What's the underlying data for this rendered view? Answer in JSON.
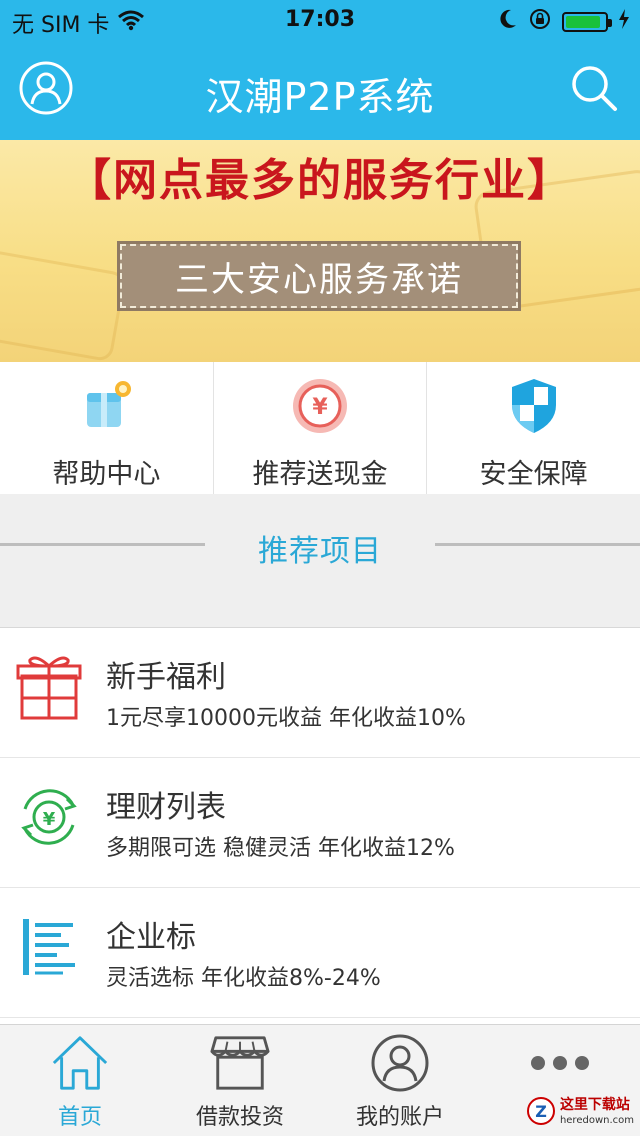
{
  "status_bar": {
    "carrier": "无 SIM 卡",
    "time": "17:03",
    "battery_level": 0.9
  },
  "header": {
    "title": "汉潮P2P系统",
    "left_icon": "user-icon",
    "right_icon": "search-icon"
  },
  "banner": {
    "headline": "【网点最多的服务行业】",
    "subtitle": "三大安心服务承诺"
  },
  "quick_menu": [
    {
      "label": "帮助中心",
      "icon": "gift-box-icon"
    },
    {
      "label": "推荐送现金",
      "icon": "yen-coin-icon"
    },
    {
      "label": "安全保障",
      "icon": "shield-icon"
    }
  ],
  "section": {
    "title": "推荐项目"
  },
  "products": [
    {
      "title": "新手福利",
      "desc": "1元尽享10000元收益 年化收益10%",
      "icon": "gift-icon"
    },
    {
      "title": "理财列表",
      "desc": "多期限可选 稳健灵活 年化收益12%",
      "icon": "yen-cycle-icon"
    },
    {
      "title": "企业标",
      "desc": "灵活选标 年化收益8%-24%",
      "icon": "list-icon"
    }
  ],
  "tab_bar": {
    "tabs": [
      {
        "label": "首页",
        "icon": "home-icon",
        "active": true
      },
      {
        "label": "借款投资",
        "icon": "shop-icon",
        "active": false
      },
      {
        "label": "我的账户",
        "icon": "account-icon",
        "active": false
      },
      {
        "label": "",
        "icon": "more-icon",
        "active": false
      }
    ]
  },
  "watermark": {
    "text": "这里下载站",
    "domain": "heredown.com"
  },
  "colors": {
    "primary": "#2bb8ea",
    "accent_text": "#2aa8d6",
    "banner_red": "#c9161d",
    "product_red": "#e03b3b",
    "product_green": "#2fae4f",
    "product_blue": "#2aa8d6"
  }
}
